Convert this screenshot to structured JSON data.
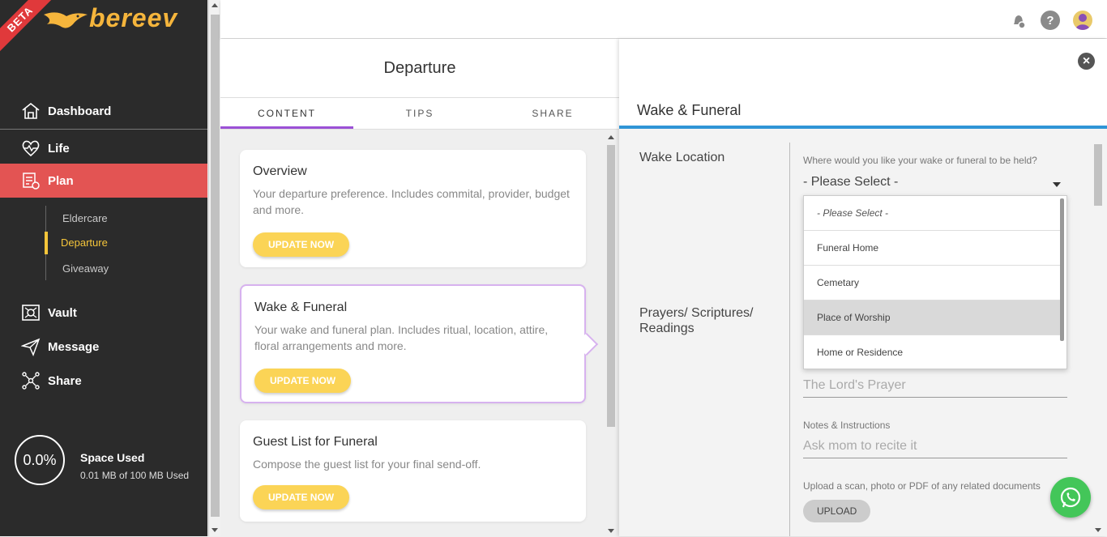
{
  "brand": {
    "name": "bereev",
    "ribbon": "BETA",
    "accent": "#f5b53c"
  },
  "sidebar": {
    "items": [
      {
        "label": "Dashboard",
        "icon": "home-icon"
      },
      {
        "label": "Life",
        "icon": "heartbeat-icon"
      },
      {
        "label": "Plan",
        "icon": "plan-checklist-icon",
        "active": true
      },
      {
        "label": "Vault",
        "icon": "vault-icon"
      },
      {
        "label": "Message",
        "icon": "paper-plane-icon"
      },
      {
        "label": "Share",
        "icon": "share-nodes-icon"
      }
    ],
    "subitems": [
      {
        "label": "Eldercare"
      },
      {
        "label": "Departure",
        "active": true
      },
      {
        "label": "Giveaway"
      }
    ],
    "space": {
      "percent": "0.0%",
      "title": "Space Used",
      "detail": "0.01 MB of 100 MB Used"
    }
  },
  "topbar": {
    "icons": [
      "bell-icon",
      "help-icon",
      "user-avatar-icon"
    ]
  },
  "middle": {
    "title": "Departure",
    "tabs": [
      "CONTENT",
      "TIPS",
      "SHARE"
    ],
    "cards": [
      {
        "title": "Overview",
        "desc": "Your departure preference. Includes commital, provider, budget and more.",
        "button": "UPDATE NOW"
      },
      {
        "title": "Wake & Funeral",
        "desc": "Your wake and funeral plan. Includes ritual, location, attire, floral arrangements and more.",
        "button": "UPDATE NOW"
      },
      {
        "title": "Guest List for Funeral",
        "desc": "Compose the guest list for your final send-off.",
        "button": "UPDATE NOW"
      }
    ]
  },
  "panel": {
    "title": "Wake & Funeral",
    "wake_location": {
      "label": "Wake Location",
      "question": "Where would you like your wake or funeral to be held?",
      "selected": "- Please Select -",
      "options": [
        "- Please Select -",
        "Funeral Home",
        "Cemetary",
        "Place of Worship",
        "Home or Residence"
      ]
    },
    "prayers": {
      "label": "Prayers/ Scriptures/ Readings",
      "placeholder": "The Lord's Prayer"
    },
    "notes": {
      "label": "Notes & Instructions",
      "placeholder": "Ask mom to recite it"
    },
    "upload": {
      "text": "Upload a scan, photo or PDF of any related documents",
      "button": "UPLOAD"
    }
  }
}
